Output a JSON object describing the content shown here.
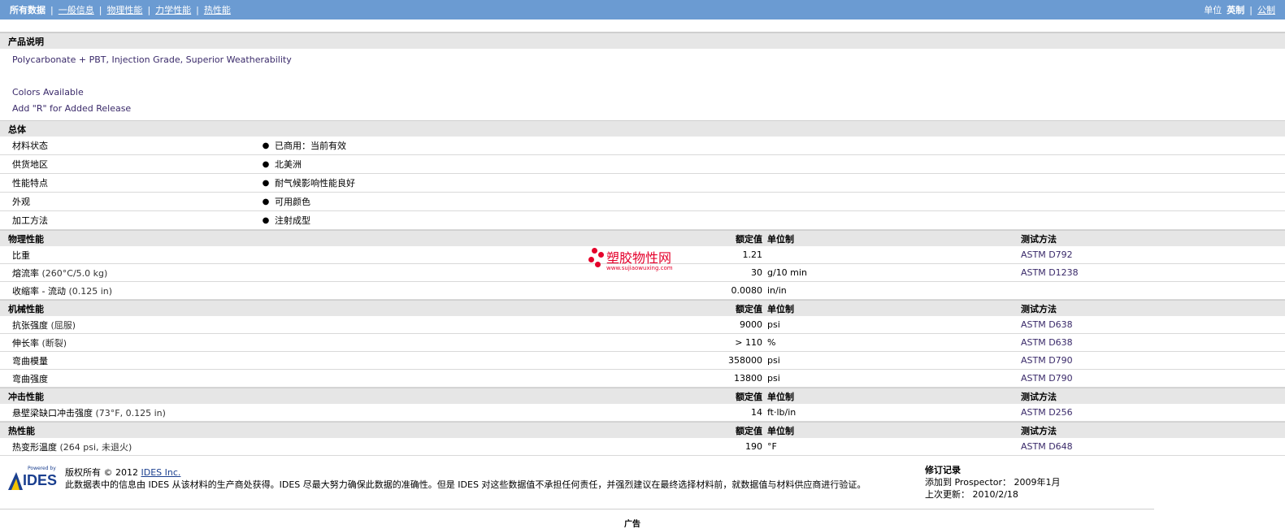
{
  "topbar": {
    "nav": [
      "所有数据",
      "一般信息",
      "物理性能",
      "力学性能",
      "热性能"
    ],
    "unit_label": "单位",
    "units": [
      "英制",
      "公制"
    ]
  },
  "description": {
    "title": "产品说明",
    "line1": "Polycarbonate + PBT, Injection Grade, Superior Weatherability",
    "line2": "Colors Available",
    "line3": "Add \"R\" for Added Release"
  },
  "general": {
    "title": "总体",
    "rows": [
      {
        "label": "材料状态",
        "value": "已商用：当前有效"
      },
      {
        "label": "供货地区",
        "value": "北美洲"
      },
      {
        "label": "性能特点",
        "value": "耐气候影响性能良好"
      },
      {
        "label": "外观",
        "value": "可用颜色"
      },
      {
        "label": "加工方法",
        "value": "注射成型"
      }
    ]
  },
  "columns": {
    "nominal": "额定值",
    "unit": "单位制",
    "test": "测试方法"
  },
  "physical": {
    "title": "物理性能",
    "rows": [
      {
        "label": "比重",
        "cond": "",
        "nominal": "1.21",
        "unit": "",
        "test": "ASTM D792"
      },
      {
        "label": "熔流率",
        "cond": "(260°C/5.0 kg)",
        "nominal": "30",
        "unit": "g/10 min",
        "test": "ASTM D1238"
      },
      {
        "label": "收缩率 - 流动",
        "cond": "(0.125 in)",
        "nominal": "0.0080",
        "unit": "in/in",
        "test": ""
      }
    ]
  },
  "mechanical": {
    "title": "机械性能",
    "rows": [
      {
        "label": "抗张强度",
        "cond": "(屈服)",
        "nominal": "9000",
        "unit": "psi",
        "test": "ASTM D638"
      },
      {
        "label": "伸长率",
        "cond": "(断裂)",
        "nominal": "> 110",
        "unit": "%",
        "test": "ASTM D638"
      },
      {
        "label": "弯曲模量",
        "cond": "",
        "nominal": "358000",
        "unit": "psi",
        "test": "ASTM D790"
      },
      {
        "label": "弯曲强度",
        "cond": "",
        "nominal": "13800",
        "unit": "psi",
        "test": "ASTM D790"
      }
    ]
  },
  "impact": {
    "title": "冲击性能",
    "rows": [
      {
        "label": "悬壁梁缺口冲击强度",
        "cond": "(73°F, 0.125 in)",
        "nominal": "14",
        "unit": "ft·lb/in",
        "test": "ASTM D256"
      }
    ]
  },
  "thermal": {
    "title": "热性能",
    "rows": [
      {
        "label": "热变形温度",
        "cond": "(264 psi, 未退火)",
        "nominal": "190",
        "unit": "°F",
        "test": "ASTM D648"
      }
    ]
  },
  "watermark": {
    "text": "塑胶物性网",
    "url": "www.sujiaowuxing.com"
  },
  "footer": {
    "logo_small": "Powered by",
    "logo_brand": "IDES",
    "copyright_prefix": "版权所有 © 2012",
    "copyright_link": "IDES Inc.",
    "disclaimer": "此数据表中的信息由 IDES 从该材料的生产商处获得。IDES 尽最大努力确保此数据的准确性。但是 IDES 对这些数据值不承担任何责任，并强烈建议在最终选择材料前，就数据值与材料供应商进行验证。",
    "revision_title": "修订记录",
    "added": "添加到 Prospector： 2009年1月",
    "updated": "上次更新： 2010/2/18",
    "ad": "广告"
  },
  "colors": {
    "topbar": "#6b9bd2",
    "section": "#e6e6e6",
    "link": "#3a2a6a",
    "watermark": "#e4002b"
  }
}
